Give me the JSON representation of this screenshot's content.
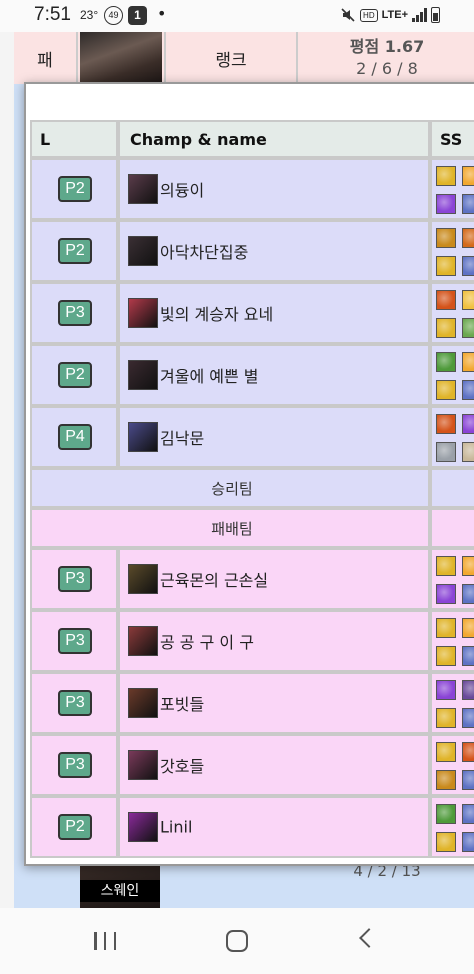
{
  "status_bar": {
    "time": "7:51",
    "temperature": "23°",
    "badge_count": "49",
    "badge_app": "1",
    "dot": "•",
    "hd_label": "HD",
    "network_label": "LTE+"
  },
  "background": {
    "loss_label": "패",
    "rank_label": "랭크",
    "score": "평점 1.67",
    "kda_top": "2 / 6 / 8",
    "bottom_champion_name": "스웨인",
    "kda_bottom": "4 / 2 / 13"
  },
  "table": {
    "headers": {
      "level": "L",
      "champ": "Champ & name",
      "spells": "SS"
    },
    "winning_team_label": "승리팀",
    "losing_team_label": "패배팀",
    "winning_team": [
      {
        "tier": "P2",
        "name": "의듕이",
        "icon_color": "#5a3c4a",
        "spells": [
          "#e0b429",
          "#8a44d6",
          "#f2a830",
          "#5e72c4"
        ]
      },
      {
        "tier": "P2",
        "name": "아닥차단집중",
        "icon_color": "#3a2f34",
        "spells": [
          "#c98a1c",
          "#e0b429",
          "#d46a1a",
          "#5e72c4"
        ]
      },
      {
        "tier": "P3",
        "name": "빛의 계승자 요네",
        "icon_color": "#b23a4a",
        "spells": [
          "#d4531a",
          "#e0b429",
          "#f0c040",
          "#6aa84f"
        ]
      },
      {
        "tier": "P2",
        "name": "겨울에 예쁜 별",
        "icon_color": "#3a2a30",
        "spells": [
          "#4e9a3a",
          "#e0b429",
          "#f2a830",
          "#5e72c4"
        ]
      },
      {
        "tier": "P4",
        "name": "김낙문",
        "icon_color": "#4a4a8a",
        "spells": [
          "#d4531a",
          "#9aa0a8",
          "#8a44d6",
          "#c8b89a"
        ]
      }
    ],
    "losing_team": [
      {
        "tier": "P3",
        "name": "근육몬의 근손실",
        "icon_color": "#5a4a2a",
        "spells": [
          "#e0b429",
          "#8a44d6",
          "#f2a830",
          "#5e72c4"
        ]
      },
      {
        "tier": "P3",
        "name": "공 공 구 이 구",
        "icon_color": "#8a3a3a",
        "spells": [
          "#e0b429",
          "#e0b429",
          "#f2a830",
          "#5e72c4"
        ]
      },
      {
        "tier": "P3",
        "name": "포빗들",
        "icon_color": "#6a3a2a",
        "spells": [
          "#8a44d6",
          "#e0b429",
          "#6a4a9a",
          "#5e72c4"
        ]
      },
      {
        "tier": "P3",
        "name": "갓호들",
        "icon_color": "#7a3a5a",
        "spells": [
          "#e0b429",
          "#c98a1c",
          "#d4531a",
          "#5e72c4"
        ]
      },
      {
        "tier": "P2",
        "name": "Linil",
        "icon_color": "#8a2a9a",
        "spells": [
          "#4e9a3a",
          "#e0b429",
          "#5e72c4",
          "#5e72c4"
        ]
      }
    ]
  }
}
